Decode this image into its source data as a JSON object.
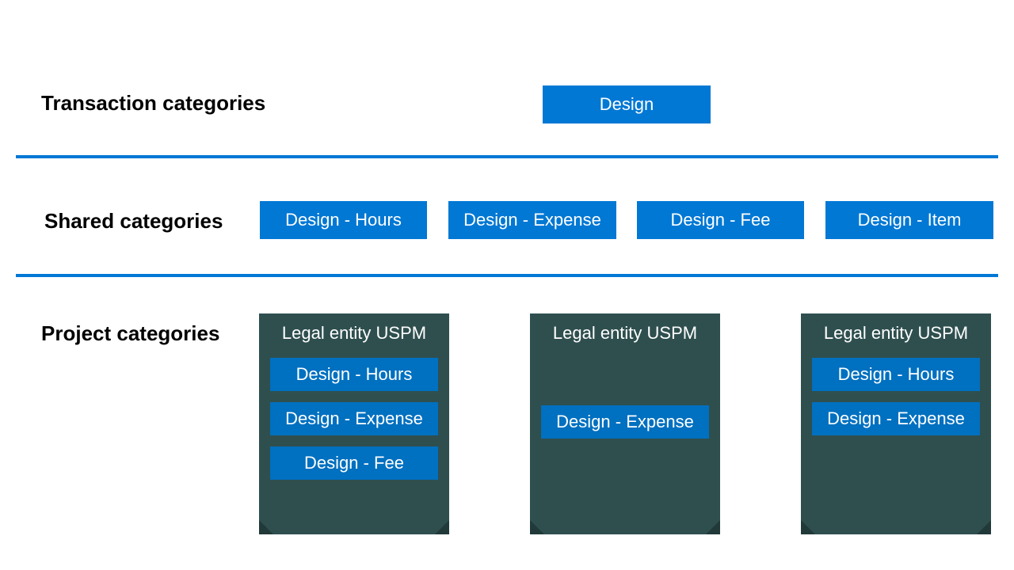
{
  "rows": {
    "transaction": {
      "label": "Transaction categories",
      "pill": "Design"
    },
    "shared": {
      "label": "Shared categories",
      "pills": [
        "Design - Hours",
        "Design - Expense",
        "Design - Fee",
        "Design - Item"
      ]
    },
    "project": {
      "label": "Project categories",
      "entities": [
        {
          "title": "Legal entity USPM",
          "items": [
            "Design - Hours",
            "Design - Expense",
            "Design - Fee"
          ]
        },
        {
          "title": "Legal entity USPM",
          "items": [
            "Design - Expense"
          ]
        },
        {
          "title": "Legal entity USPM",
          "items": [
            "Design - Hours",
            "Design - Expense"
          ]
        }
      ]
    }
  },
  "colors": {
    "accent_blue": "#0078d4",
    "panel_bg": "#2f4f4f",
    "inner_blue": "#0070c0"
  }
}
